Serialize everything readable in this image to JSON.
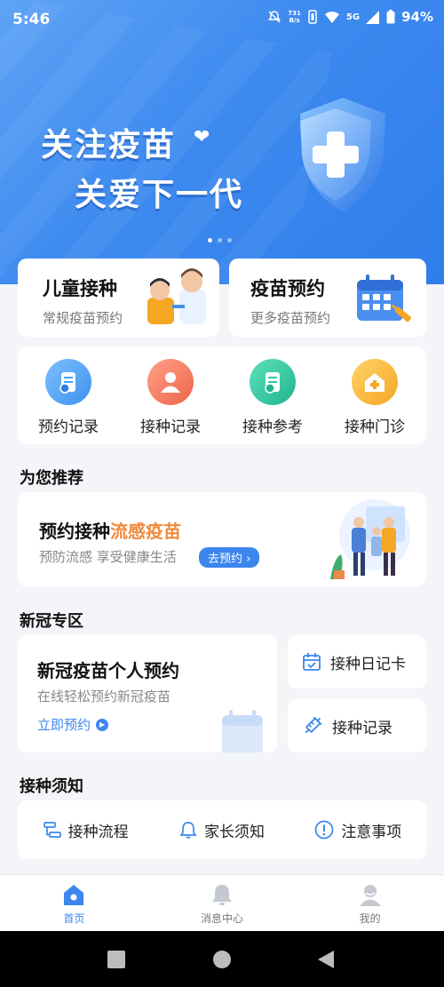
{
  "status_bar": {
    "time": "5:46",
    "net_speed_value": "731",
    "net_speed_unit": "B/s",
    "network": "5G",
    "battery": "94%"
  },
  "banner": {
    "title_line1": "关注疫苗",
    "title_line2": "关爱下一代"
  },
  "top_cards": [
    {
      "title": "儿童接种",
      "subtitle": "常规疫苗预约"
    },
    {
      "title": "疫苗预约",
      "subtitle": "更多疫苗预约"
    }
  ],
  "quick_actions": [
    {
      "label": "预约记录",
      "icon": "appointment-record-icon",
      "color": "#4aa3f2"
    },
    {
      "label": "接种记录",
      "icon": "vaccination-record-icon",
      "color": "#f47b5c"
    },
    {
      "label": "接种参考",
      "icon": "vaccination-reference-icon",
      "color": "#31c79e"
    },
    {
      "label": "接种门诊",
      "icon": "clinic-icon",
      "color": "#f7b733"
    }
  ],
  "recommend": {
    "section_title": "为您推荐",
    "title_prefix": "预约接种",
    "title_highlight": "流感疫苗",
    "subtitle": "预防流感 享受健康生活",
    "button": "去预约"
  },
  "ncov": {
    "section_title": "新冠专区",
    "main_title": "新冠疫苗个人预约",
    "main_subtitle": "在线轻松预约新冠疫苗",
    "main_link": "立即预约",
    "side_items": [
      {
        "label": "接种日记卡",
        "icon": "calendar-check-icon"
      },
      {
        "label": "接种记录",
        "icon": "syringe-icon"
      }
    ]
  },
  "notice": {
    "section_title": "接种须知",
    "items": [
      {
        "label": "接种流程",
        "icon": "flow-icon"
      },
      {
        "label": "家长须知",
        "icon": "bell-icon"
      },
      {
        "label": "注意事项",
        "icon": "alert-icon"
      }
    ]
  },
  "tabbar": [
    {
      "label": "首页",
      "icon": "home-icon",
      "active": true
    },
    {
      "label": "消息中心",
      "icon": "bell-icon",
      "active": false
    },
    {
      "label": "我的",
      "icon": "profile-icon",
      "active": false
    }
  ],
  "colors": {
    "accent": "#3c86ee",
    "highlight": "#f08a3e",
    "banner": "#3d8af0"
  }
}
